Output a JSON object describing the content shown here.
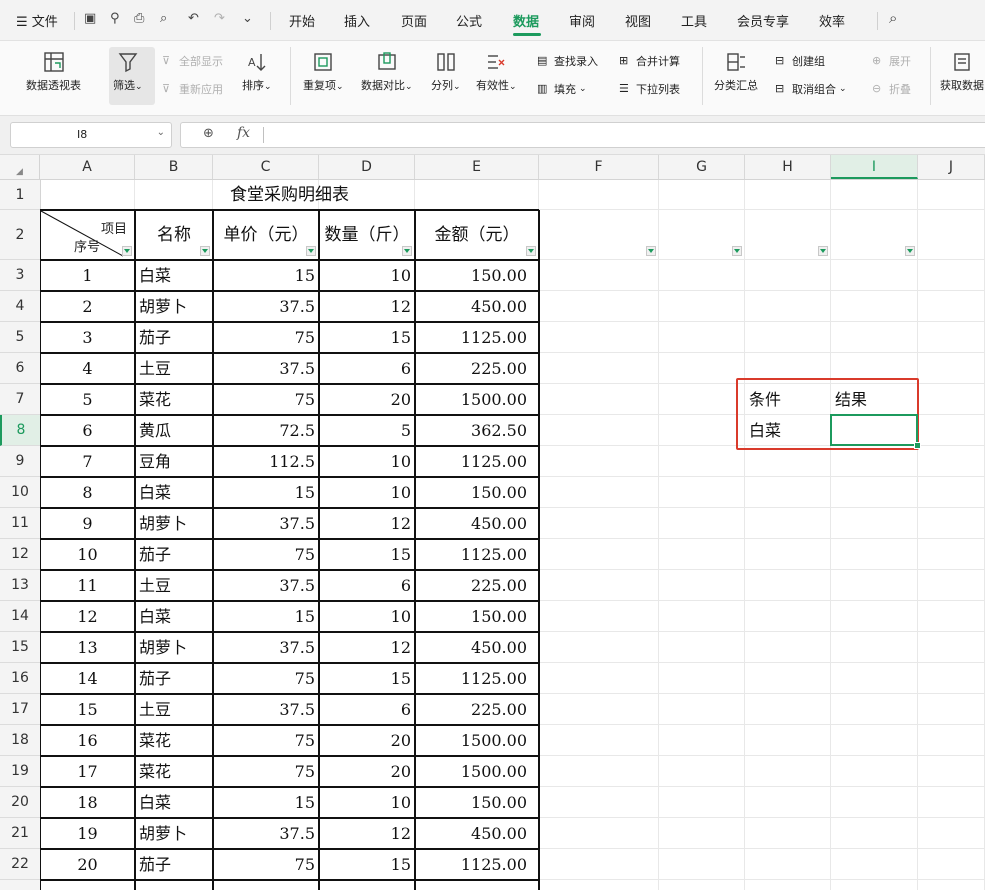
{
  "menubar": {
    "file": "文件",
    "tabs": [
      "开始",
      "插入",
      "页面",
      "公式",
      "数据",
      "审阅",
      "视图",
      "工具",
      "会员专享",
      "效率"
    ],
    "active_tab": "数据"
  },
  "ribbon": {
    "pivot": "数据透视表",
    "filter": "筛选",
    "show_all": "全部显示",
    "reapply": "重新应用",
    "sort": "排序",
    "duplicates": "重复项",
    "compare": "数据对比",
    "split": "分列",
    "validity": "有效性",
    "lookup_entry": "查找录入",
    "fill": "填充",
    "consolidate": "合并计算",
    "dropdown_list": "下拉列表",
    "subtotal": "分类汇总",
    "create_group": "创建组",
    "ungroup": "取消组合",
    "expand": "展开",
    "collapse": "折叠",
    "get_data": "获取数据"
  },
  "formula_bar": {
    "name_box": "I8",
    "fx": "fx",
    "content": ""
  },
  "columns": [
    "A",
    "B",
    "C",
    "D",
    "E",
    "F",
    "G",
    "H",
    "I",
    "J"
  ],
  "selected_column": "I",
  "selected_row": "8",
  "rows": [
    "1",
    "2",
    "3",
    "4",
    "5",
    "6",
    "7",
    "8",
    "9",
    "10",
    "11",
    "12",
    "13",
    "14",
    "15",
    "16",
    "17",
    "18",
    "19",
    "20",
    "21",
    "22"
  ],
  "sheet": {
    "title": "食堂采购明细表",
    "header": {
      "corner_top": "项目",
      "corner_bottom": "序号",
      "name": "名称",
      "price": "单价（元）",
      "qty": "数量（斤）",
      "amount": "金额（元）"
    },
    "data": [
      [
        "1",
        "白菜",
        "15",
        "10",
        "150.00"
      ],
      [
        "2",
        "胡萝卜",
        "37.5",
        "12",
        "450.00"
      ],
      [
        "3",
        "茄子",
        "75",
        "15",
        "1125.00"
      ],
      [
        "4",
        "土豆",
        "37.5",
        "6",
        "225.00"
      ],
      [
        "5",
        "菜花",
        "75",
        "20",
        "1500.00"
      ],
      [
        "6",
        "黄瓜",
        "72.5",
        "5",
        "362.50"
      ],
      [
        "7",
        "豆角",
        "112.5",
        "10",
        "1125.00"
      ],
      [
        "8",
        "白菜",
        "15",
        "10",
        "150.00"
      ],
      [
        "9",
        "胡萝卜",
        "37.5",
        "12",
        "450.00"
      ],
      [
        "10",
        "茄子",
        "75",
        "15",
        "1125.00"
      ],
      [
        "11",
        "土豆",
        "37.5",
        "6",
        "225.00"
      ],
      [
        "12",
        "白菜",
        "15",
        "10",
        "150.00"
      ],
      [
        "13",
        "胡萝卜",
        "37.5",
        "12",
        "450.00"
      ],
      [
        "14",
        "茄子",
        "75",
        "15",
        "1125.00"
      ],
      [
        "15",
        "土豆",
        "37.5",
        "6",
        "225.00"
      ],
      [
        "16",
        "菜花",
        "75",
        "20",
        "1500.00"
      ],
      [
        "17",
        "菜花",
        "75",
        "20",
        "1500.00"
      ],
      [
        "18",
        "白菜",
        "15",
        "10",
        "150.00"
      ],
      [
        "19",
        "胡萝卜",
        "37.5",
        "12",
        "450.00"
      ],
      [
        "20",
        "茄子",
        "75",
        "15",
        "1125.00"
      ]
    ],
    "criteria": {
      "label_condition": "条件",
      "label_result": "结果",
      "condition_value": "白菜",
      "result_value": ""
    }
  },
  "colors": {
    "accent": "#1c9a5d",
    "highlight_box": "#d93a2b"
  }
}
